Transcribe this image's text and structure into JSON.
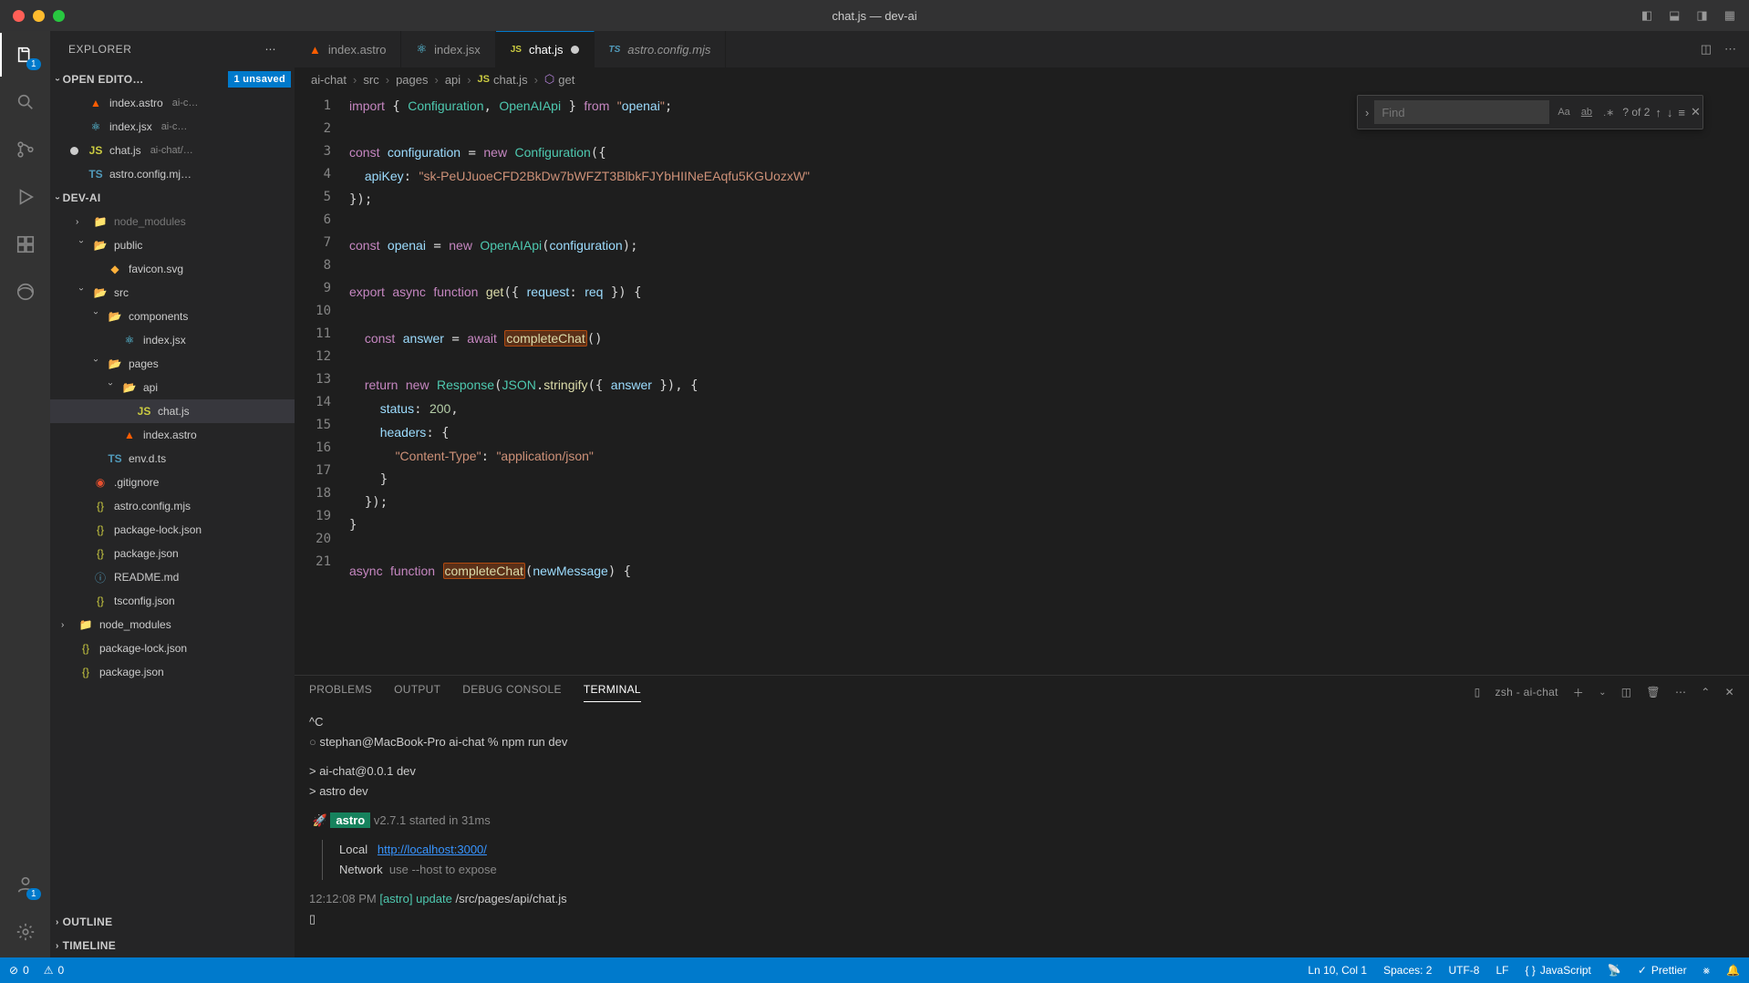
{
  "window": {
    "title": "chat.js — dev-ai"
  },
  "sidebar": {
    "title": "EXPLORER",
    "openEditors": {
      "label": "OPEN EDITO…",
      "unsavedBadge": "1 unsaved",
      "items": [
        {
          "name": "index.astro",
          "hint": "ai-c…",
          "icon": "astro"
        },
        {
          "name": "index.jsx",
          "hint": "ai-c…",
          "icon": "react"
        },
        {
          "name": "chat.js",
          "hint": "ai-chat/…",
          "icon": "js",
          "modified": true
        },
        {
          "name": "astro.config.mj…",
          "hint": "",
          "icon": "ts"
        }
      ]
    },
    "project": {
      "label": "DEV-AI",
      "tree": [
        {
          "depth": 1,
          "name": "node_modules",
          "type": "folder",
          "dim": true
        },
        {
          "depth": 1,
          "name": "public",
          "type": "folder-open"
        },
        {
          "depth": 2,
          "name": "favicon.svg",
          "type": "file",
          "icon": "svg"
        },
        {
          "depth": 1,
          "name": "src",
          "type": "folder-open"
        },
        {
          "depth": 2,
          "name": "components",
          "type": "folder-open"
        },
        {
          "depth": 3,
          "name": "index.jsx",
          "type": "file",
          "icon": "react"
        },
        {
          "depth": 2,
          "name": "pages",
          "type": "folder-open"
        },
        {
          "depth": 3,
          "name": "api",
          "type": "folder-open"
        },
        {
          "depth": 4,
          "name": "chat.js",
          "type": "file",
          "icon": "js",
          "active": true
        },
        {
          "depth": 3,
          "name": "index.astro",
          "type": "file",
          "icon": "astro"
        },
        {
          "depth": 2,
          "name": "env.d.ts",
          "type": "file",
          "icon": "ts"
        },
        {
          "depth": 1,
          "name": ".gitignore",
          "type": "file",
          "icon": "git"
        },
        {
          "depth": 1,
          "name": "astro.config.mjs",
          "type": "file",
          "icon": "json"
        },
        {
          "depth": 1,
          "name": "package-lock.json",
          "type": "file",
          "icon": "json"
        },
        {
          "depth": 1,
          "name": "package.json",
          "type": "file",
          "icon": "json"
        },
        {
          "depth": 1,
          "name": "README.md",
          "type": "file",
          "icon": "info"
        },
        {
          "depth": 1,
          "name": "tsconfig.json",
          "type": "file",
          "icon": "json"
        },
        {
          "depth": 0,
          "name": "node_modules",
          "type": "folder"
        },
        {
          "depth": 0,
          "name": "package-lock.json",
          "type": "file",
          "icon": "json"
        },
        {
          "depth": 0,
          "name": "package.json",
          "type": "file",
          "icon": "json"
        }
      ]
    },
    "outline": "OUTLINE",
    "timeline": "TIMELINE"
  },
  "tabs": [
    {
      "name": "index.astro",
      "icon": "astro"
    },
    {
      "name": "index.jsx",
      "icon": "react"
    },
    {
      "name": "chat.js",
      "icon": "js",
      "active": true,
      "modified": true
    },
    {
      "name": "astro.config.mjs",
      "icon": "ts",
      "italic": true
    }
  ],
  "breadcrumb": [
    "ai-chat",
    "src",
    "pages",
    "api",
    "chat.js",
    "get"
  ],
  "find": {
    "placeholder": "Find",
    "count": "? of 2"
  },
  "code": {
    "startLine": 1,
    "lines": [
      "import { Configuration, OpenAIApi } from \"openai\";",
      "",
      "const configuration = new Configuration({",
      "  apiKey: \"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\"",
      "});",
      "",
      "const openai = new OpenAIApi(configuration);",
      "",
      "export async function get({ request: req }) {",
      "",
      "  const answer = await completeChat()",
      "",
      "  return new Response(JSON.stringify({ answer }), {",
      "    status: 200,",
      "    headers: {",
      "      \"Content-Type\": \"application/json\"",
      "    }",
      "  });",
      "}",
      "",
      "async function completeChat(newMessage) {"
    ]
  },
  "panel": {
    "tabs": [
      "PROBLEMS",
      "OUTPUT",
      "DEBUG CONSOLE",
      "TERMINAL"
    ],
    "active": 3,
    "terminalLabel": "zsh - ai-chat",
    "terminal": {
      "line1": "^C",
      "prompt": "stephan@MacBook-Pro ai-chat % npm run dev",
      "out1": "> ai-chat@0.0.1 dev",
      "out2": "> astro dev",
      "astro_label": "astro",
      "astro_ver": "v2.7.1 started in 31ms",
      "local_label": "Local",
      "local_url": "http://localhost:3000/",
      "net_label": "Network",
      "net_hint": "use --host to expose",
      "log_time": "12:12:08 PM",
      "log_tag": "[astro]",
      "log_action": "update",
      "log_path": "/src/pages/api/chat.js"
    }
  },
  "status": {
    "errors": "0",
    "warnings": "0",
    "cursor": "Ln 10, Col 1",
    "spaces": "Spaces: 2",
    "encoding": "UTF-8",
    "eol": "LF",
    "lang": "JavaScript",
    "prettier": "Prettier"
  }
}
